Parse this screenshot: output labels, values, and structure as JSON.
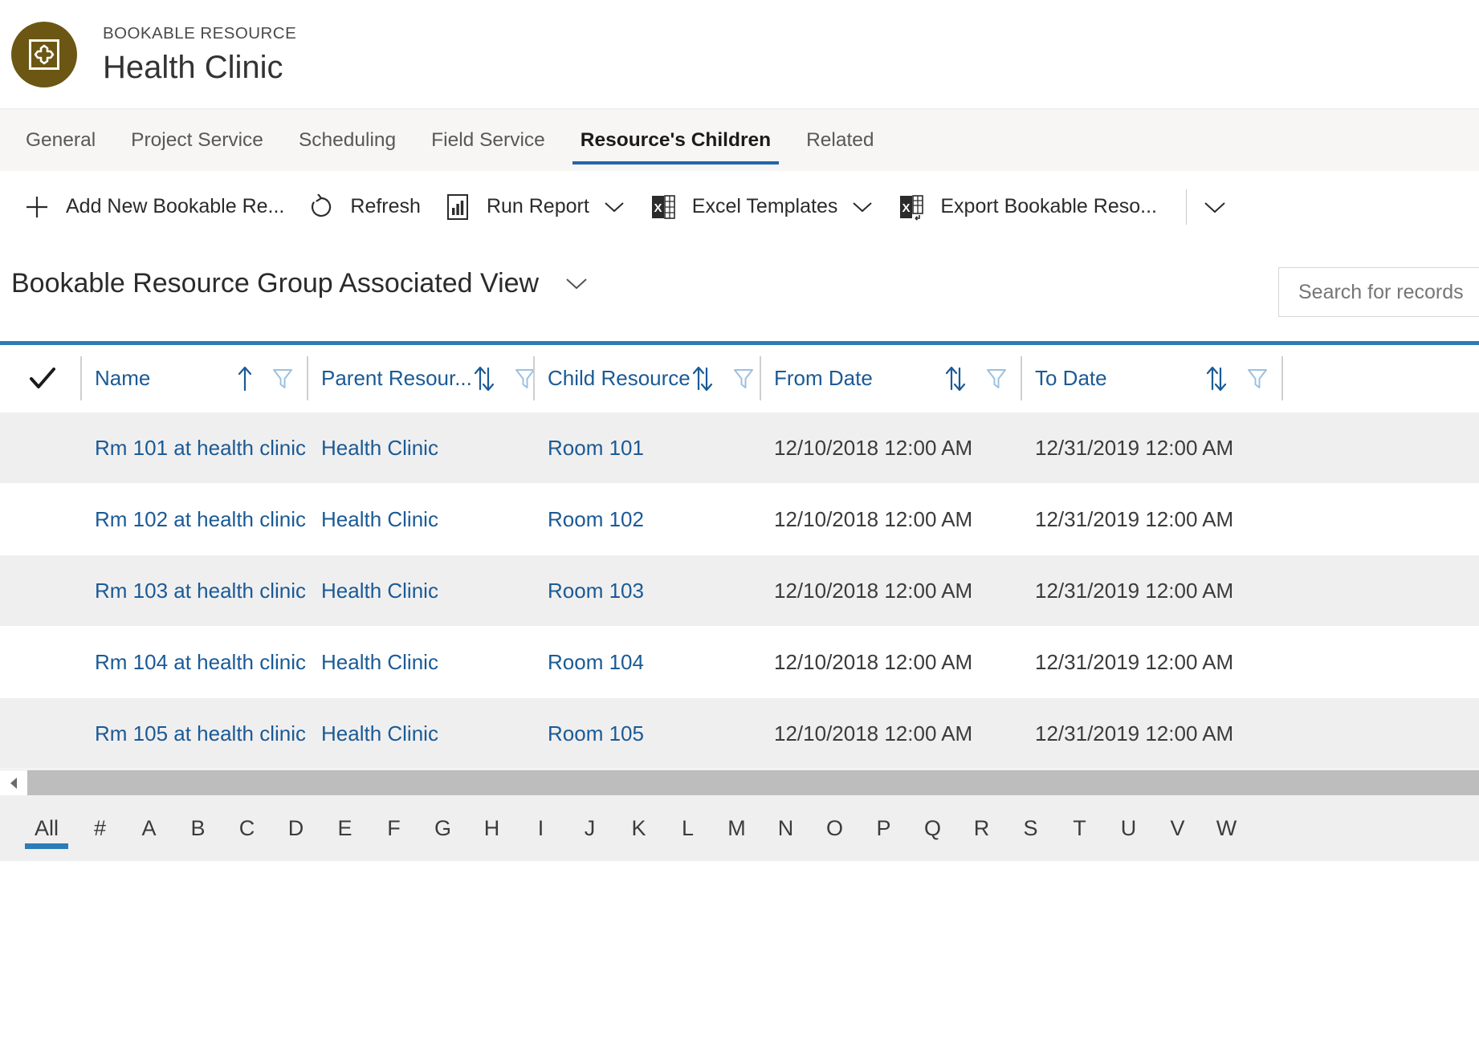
{
  "header": {
    "entity_type": "BOOKABLE RESOURCE",
    "record_title": "Health Clinic",
    "avatar_icon": "bookable-resource-icon",
    "avatar_color": "#6b5713"
  },
  "tabs": [
    {
      "label": "General",
      "active": false
    },
    {
      "label": "Project Service",
      "active": false
    },
    {
      "label": "Scheduling",
      "active": false
    },
    {
      "label": "Field Service",
      "active": false
    },
    {
      "label": "Resource's Children",
      "active": true
    },
    {
      "label": "Related",
      "active": false
    }
  ],
  "commandbar": {
    "items": [
      {
        "label": "Add New Bookable Re...",
        "icon": "plus-icon",
        "caret": false
      },
      {
        "label": "Refresh",
        "icon": "refresh-icon",
        "caret": false
      },
      {
        "label": "Run Report",
        "icon": "report-icon",
        "caret": true
      },
      {
        "label": "Excel Templates",
        "icon": "excel-icon",
        "caret": true
      },
      {
        "label": "Export Bookable Reso...",
        "icon": "excel-export-icon",
        "caret": true
      }
    ],
    "overflow_icon": "chevron-down-icon"
  },
  "view": {
    "title": "Bookable Resource Group Associated View",
    "selector_icon": "chevron-down-icon"
  },
  "search": {
    "placeholder": "Search for records",
    "value": ""
  },
  "grid": {
    "accent_color": "#2b7cb9",
    "select_all_icon": "checkmark-icon",
    "columns": [
      {
        "label": "Name",
        "sort": "ascending",
        "sort_icon": "arrow-up-icon",
        "filter_icon": "filter-icon"
      },
      {
        "label": "Parent Resour...",
        "sort": "none",
        "sort_icon": "sort-updown-icon",
        "filter_icon": "filter-icon"
      },
      {
        "label": "Child Resource",
        "sort": "none",
        "sort_icon": "sort-updown-icon",
        "filter_icon": "filter-icon"
      },
      {
        "label": "From Date",
        "sort": "none",
        "sort_icon": "sort-updown-icon",
        "filter_icon": "filter-icon"
      },
      {
        "label": "To Date",
        "sort": "none",
        "sort_icon": "sort-updown-icon",
        "filter_icon": "filter-icon"
      }
    ],
    "rows": [
      {
        "name": "Rm 101 at health clinic",
        "parent": "Health Clinic",
        "child": "Room 101",
        "from": "12/10/2018 12:00 AM",
        "to": "12/31/2019 12:00 AM"
      },
      {
        "name": "Rm 102 at health clinic",
        "parent": "Health Clinic",
        "child": "Room 102",
        "from": "12/10/2018 12:00 AM",
        "to": "12/31/2019 12:00 AM"
      },
      {
        "name": "Rm 103 at health clinic",
        "parent": "Health Clinic",
        "child": "Room 103",
        "from": "12/10/2018 12:00 AM",
        "to": "12/31/2019 12:00 AM"
      },
      {
        "name": "Rm 104 at health clinic",
        "parent": "Health Clinic",
        "child": "Room 104",
        "from": "12/10/2018 12:00 AM",
        "to": "12/31/2019 12:00 AM"
      },
      {
        "name": "Rm 105 at health clinic",
        "parent": "Health Clinic",
        "child": "Room 105",
        "from": "12/10/2018 12:00 AM",
        "to": "12/31/2019 12:00 AM"
      }
    ]
  },
  "alpha_filter": {
    "selected": "All",
    "items": [
      "All",
      "#",
      "A",
      "B",
      "C",
      "D",
      "E",
      "F",
      "G",
      "H",
      "I",
      "J",
      "K",
      "L",
      "M",
      "N",
      "O",
      "P",
      "Q",
      "R",
      "S",
      "T",
      "U",
      "V",
      "W"
    ]
  }
}
